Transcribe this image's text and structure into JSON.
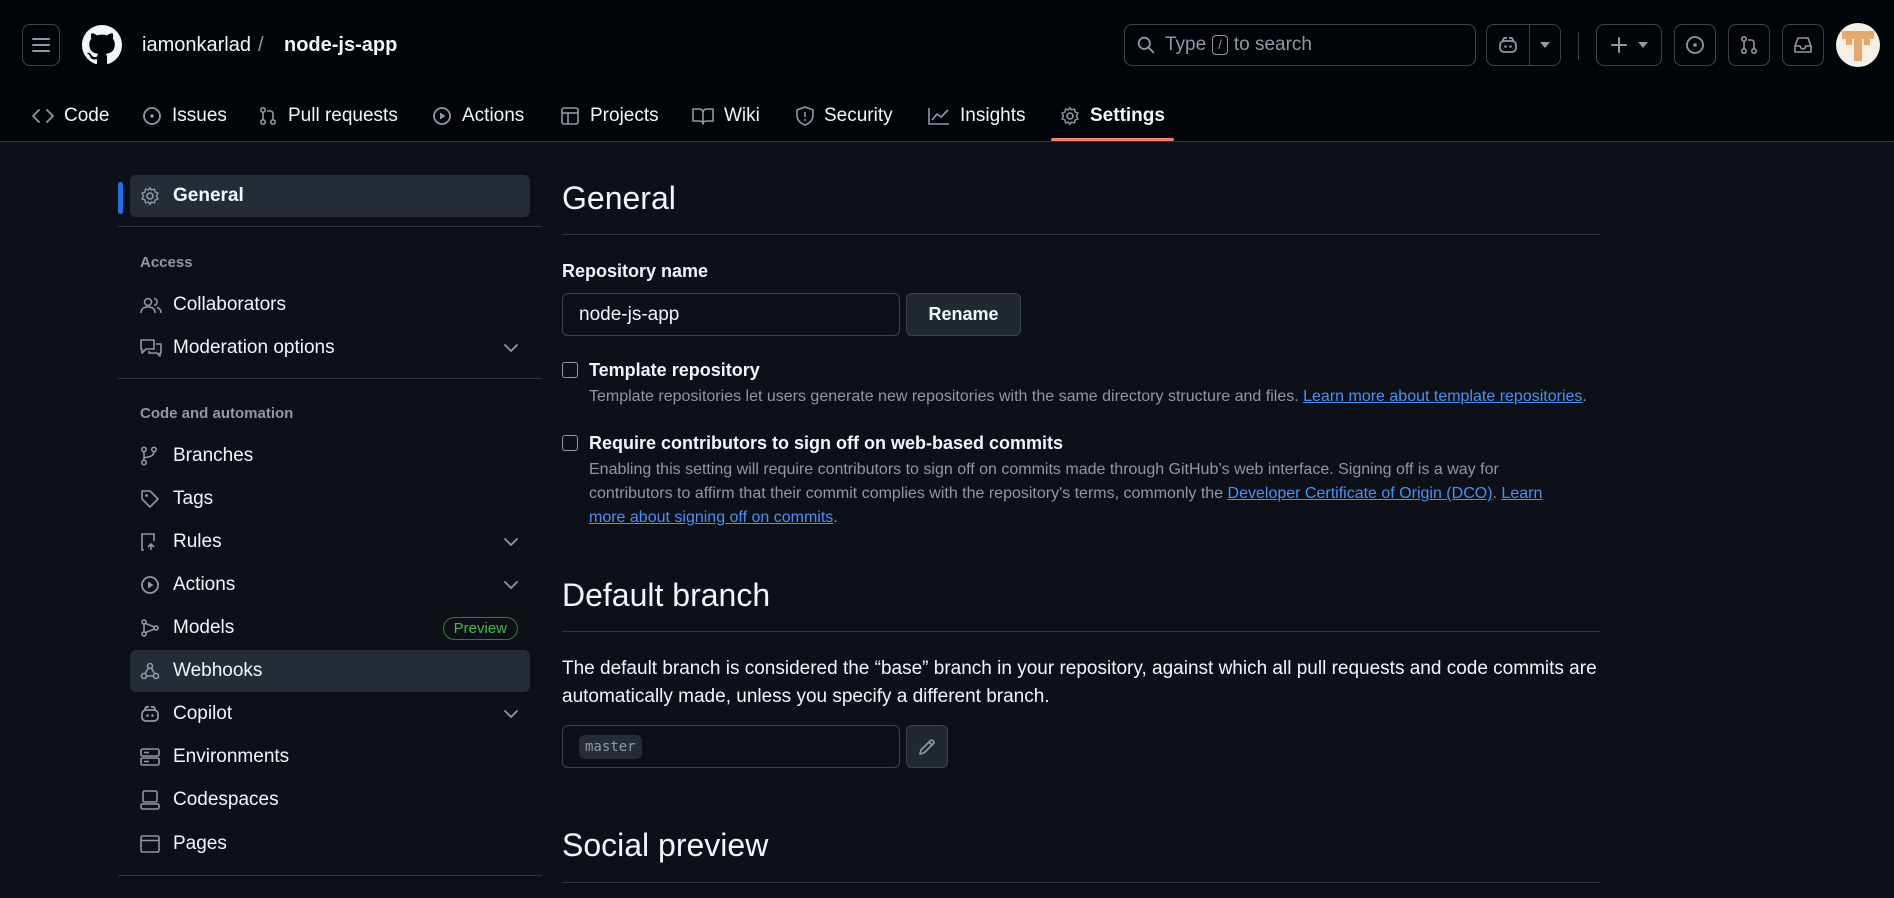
{
  "header": {
    "owner": "iamonkarlad",
    "separator": "/",
    "repo": "node-js-app",
    "search": {
      "pre": "Type",
      "key": "/",
      "post": "to search"
    }
  },
  "tabs": [
    {
      "label": "Code",
      "icon": "code-icon"
    },
    {
      "label": "Issues",
      "icon": "issue-opened-icon"
    },
    {
      "label": "Pull requests",
      "icon": "git-pull-request-icon"
    },
    {
      "label": "Actions",
      "icon": "play-icon"
    },
    {
      "label": "Projects",
      "icon": "table-icon"
    },
    {
      "label": "Wiki",
      "icon": "book-icon"
    },
    {
      "label": "Security",
      "icon": "shield-icon"
    },
    {
      "label": "Insights",
      "icon": "graph-icon"
    },
    {
      "label": "Settings",
      "icon": "gear-icon"
    }
  ],
  "sidebar": {
    "general": "General",
    "access_heading": "Access",
    "collaborators": "Collaborators",
    "moderation": "Moderation options",
    "code_heading": "Code and automation",
    "branches": "Branches",
    "tags": "Tags",
    "rules": "Rules",
    "actions": "Actions",
    "models": "Models",
    "models_badge": "Preview",
    "webhooks": "Webhooks",
    "copilot": "Copilot",
    "environments": "Environments",
    "codespaces": "Codespaces",
    "pages": "Pages"
  },
  "main": {
    "general_title": "General",
    "repo_name_label": "Repository name",
    "repo_name_value": "node-js-app",
    "rename_button": "Rename",
    "template": {
      "label": "Template repository",
      "desc": "Template repositories let users generate new repositories with the same directory structure and files.",
      "link": "Learn more about template repositories",
      "tail": "."
    },
    "signoff": {
      "label": "Require contributors to sign off on web-based commits",
      "desc1": "Enabling this setting will require contributors to sign off on commits made through GitHub’s web interface. Signing off is a way for",
      "desc2": "contributors to affirm that their commit complies with the repository's terms, commonly the",
      "link1": "Developer Certificate of Origin (DCO)",
      "mid": ".",
      "link2a": "Learn",
      "link2b": "more about signing off on commits",
      "tail": "."
    },
    "default_branch_title": "Default branch",
    "default_branch_desc1": "The default branch is considered the “base” branch in your repository, against which all pull requests and code commits are",
    "default_branch_desc2": "automatically made, unless you specify a different branch.",
    "branch_value": "master",
    "social_preview_title": "Social preview"
  },
  "colors": {
    "accent": "#1f6feb",
    "tab_underline": "#f78166",
    "link": "#4493f8",
    "badge": "#3fb950"
  }
}
